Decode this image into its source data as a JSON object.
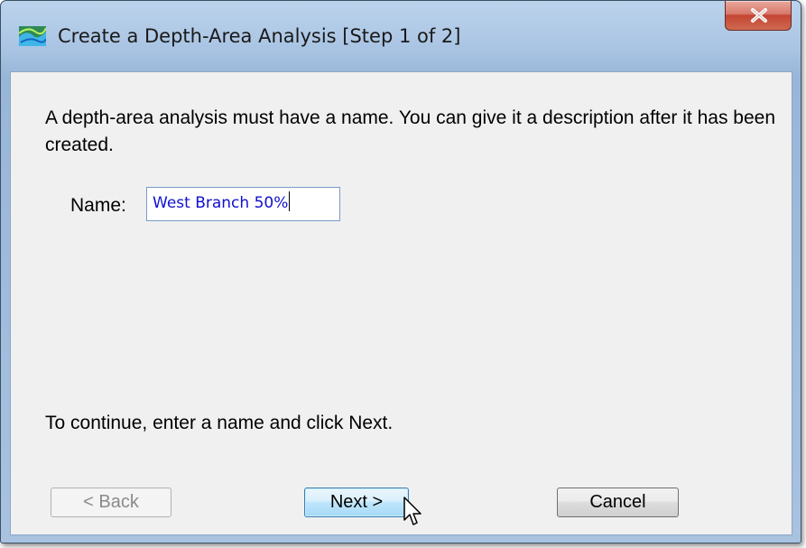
{
  "window": {
    "title": "Create a Depth-Area Analysis [Step 1 of 2]",
    "icon": "app-map-icon",
    "close_icon": "close-icon"
  },
  "content": {
    "message": "A depth-area analysis must have a name. You can give it a description after it has been created.",
    "name_label": "Name:",
    "name_value": "West Branch 50%",
    "instruction": "To continue, enter a name and click Next."
  },
  "buttons": {
    "back": "< Back",
    "next": "Next >",
    "cancel": "Cancel"
  },
  "colors": {
    "input_text": "#1010d0",
    "dialog_bg": "#f0f0f0",
    "close_button": "#c44532"
  }
}
